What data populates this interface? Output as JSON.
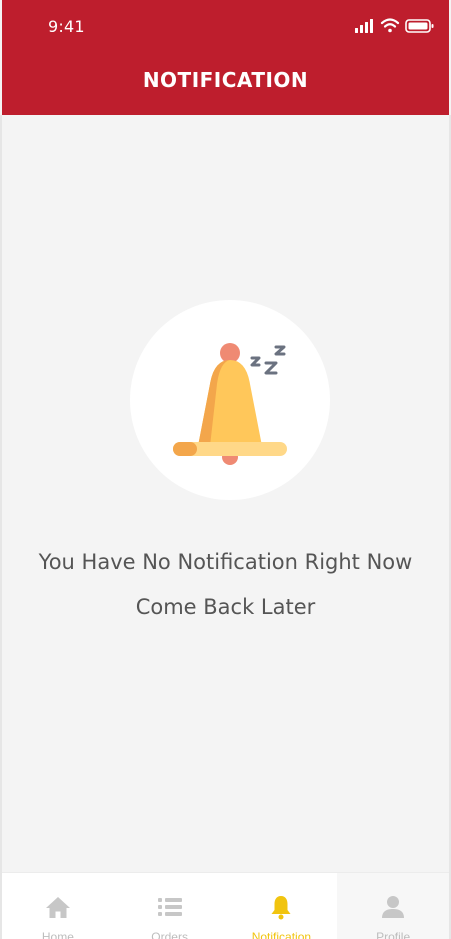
{
  "status_bar": {
    "time": "9:41"
  },
  "header": {
    "title": "NOTIFICATION",
    "background": "#be1e2d"
  },
  "empty_state": {
    "line1": "You Have No Notification Right Now",
    "line2": "Come Back Later",
    "icon": "sleeping-bell-icon",
    "colors": {
      "bell": "#ffc75a",
      "bell_shade": "#f3a64b",
      "knob": "#ef8a73",
      "zzz": "#6b7280"
    }
  },
  "bottom_nav": {
    "active_color": "#f1c40f",
    "inactive_color": "#bdbdbd",
    "items": [
      {
        "label": "Home",
        "icon": "home-icon",
        "active": false
      },
      {
        "label": "Orders",
        "icon": "list-icon",
        "active": false
      },
      {
        "label": "Notification",
        "icon": "bell-icon",
        "active": true
      },
      {
        "label": "Profile",
        "icon": "user-icon",
        "active": false
      }
    ]
  }
}
